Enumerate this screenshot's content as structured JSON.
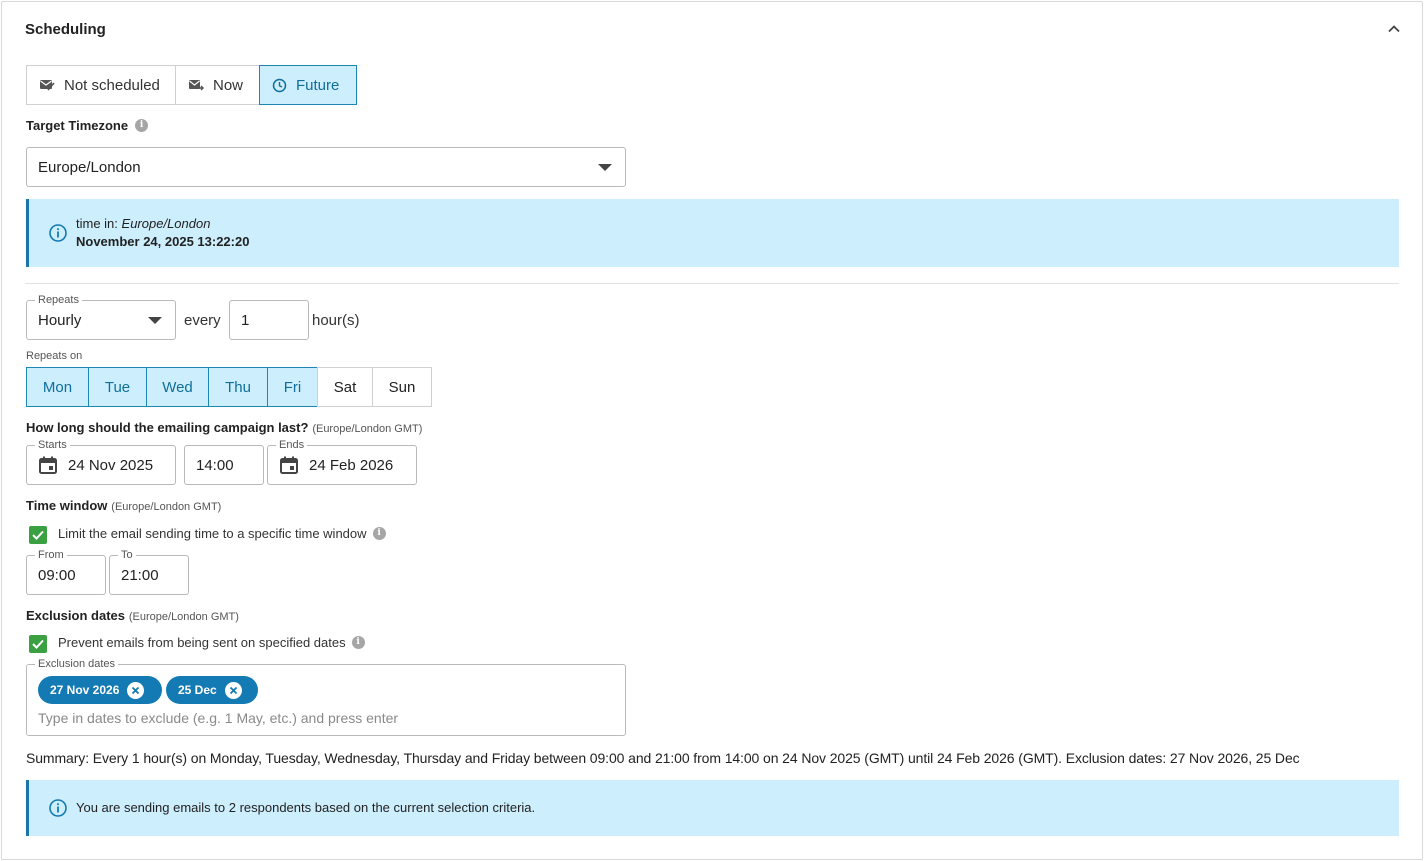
{
  "section": {
    "title": "Scheduling"
  },
  "schedule_modes": [
    {
      "label": "Not scheduled",
      "icon": "mail-off-icon",
      "active": false
    },
    {
      "label": "Now",
      "icon": "mail-send-icon",
      "active": false
    },
    {
      "label": "Future",
      "icon": "clock-icon",
      "active": true
    }
  ],
  "timezone": {
    "label": "Target Timezone",
    "value": "Europe/London",
    "time_prefix": "time in:",
    "time_zone_name": "Europe/London",
    "current_time": "November 24, 2025 13:22:20"
  },
  "repeats": {
    "label": "Repeats",
    "value": "Hourly",
    "every_label": "every",
    "every_value": "1",
    "unit_label": "hour(s)",
    "repeats_on_label": "Repeats on",
    "days": [
      {
        "label": "Mon",
        "selected": true
      },
      {
        "label": "Tue",
        "selected": true
      },
      {
        "label": "Wed",
        "selected": true
      },
      {
        "label": "Thu",
        "selected": true
      },
      {
        "label": "Fri",
        "selected": true
      },
      {
        "label": "Sat",
        "selected": false
      },
      {
        "label": "Sun",
        "selected": false
      }
    ]
  },
  "duration": {
    "question": "How long should the emailing campaign last?",
    "tz_note": "(Europe/London GMT)",
    "starts_label": "Starts",
    "starts_date": "24 Nov 2025",
    "starts_time": "14:00",
    "ends_label": "Ends",
    "ends_date": "24 Feb 2026"
  },
  "time_window": {
    "label": "Time window",
    "tz_note": "(Europe/London GMT)",
    "checkbox_label": "Limit the email sending time to a specific time window",
    "checked": true,
    "from_label": "From",
    "from_value": "09:00",
    "to_label": "To",
    "to_value": "21:00"
  },
  "exclusion": {
    "label": "Exclusion dates",
    "tz_note": "(Europe/London GMT)",
    "checkbox_label": "Prevent emails from being sent on specified dates",
    "checked": true,
    "field_label": "Exclusion dates",
    "chips": [
      "27 Nov 2026",
      "25 Dec"
    ],
    "placeholder": "Type in dates to exclude (e.g. 1 May, etc.) and press enter"
  },
  "summary": "Summary: Every 1 hour(s) on Monday, Tuesday, Wednesday, Thursday and Friday between 09:00 and 21:00 from 14:00 on 24 Nov 2025 (GMT) until 24 Feb 2026 (GMT). Exclusion dates: 27 Nov 2026, 25 Dec",
  "respondents_notice": "You are sending emails to 2 respondents based on the current selection criteria.",
  "colors": {
    "accent": "#137ab4",
    "accent_bg": "#cdeefc",
    "check_green": "#3aa041"
  }
}
